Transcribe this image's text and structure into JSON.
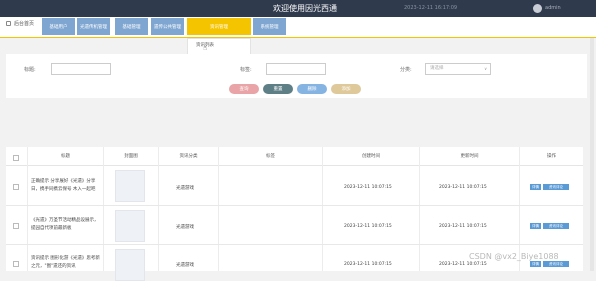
{
  "header": {
    "title": "欢迎使用因光西通",
    "datetime": "2023-12-11 16:17:09",
    "username": "admin"
  },
  "nav": {
    "home": "后台首页",
    "items": [
      "基础用户",
      "光遗传机管理",
      "基础管理",
      "遗传公共管理",
      "资讯管理",
      "系统管理"
    ],
    "active_index": 4
  },
  "dropdown": {
    "items": [
      "资讯列表",
      "资讯分类"
    ]
  },
  "search": {
    "title_label": "标题:",
    "tag_label": "标签:",
    "category_label": "分类:",
    "category_placeholder": "请选择",
    "buttons": [
      "查询",
      "重置",
      "删除",
      "添加"
    ]
  },
  "table": {
    "columns": [
      "",
      "标题",
      "封面图",
      "资讯分类",
      "标签",
      "创建时间",
      "更新时间",
      "操作"
    ],
    "rows": [
      {
        "title": "正确提示 分享展好《光遗》分享日，携手同携云保号 木入一起吧",
        "category": "光遗游戏",
        "created": "2023-12-11 10:07:15",
        "updated": "2023-12-11 10:07:15",
        "actions": [
          "详情",
          "资讯评论"
        ]
      },
      {
        "title": "《光遗》万圣节活动精品设展示，提园自代项前最新板",
        "category": "光遗游戏",
        "created": "2023-12-11 10:07:15",
        "updated": "2023-12-11 10:07:15",
        "actions": [
          "详情",
          "资讯评论"
        ]
      },
      {
        "title": "资讯提示 图形化游《光遗》思考新之元，\"图\"遗还的资讯",
        "category": "光遗游戏",
        "created": "2023-12-11 10:07:15",
        "updated": "2023-12-11 10:07:15",
        "actions": [
          "详情",
          "资讯评论"
        ]
      }
    ]
  },
  "watermark": "CSDN @vx2_Biye1088",
  "colors": {
    "topbar": "#2f3a4c",
    "nav_item": "#7fa6d1",
    "nav_active": "#f5c400",
    "btn_search": "#e8a4a6",
    "btn_reset": "#5f7f87",
    "btn_delete": "#86b4e2",
    "btn_add": "#dfc99a"
  }
}
